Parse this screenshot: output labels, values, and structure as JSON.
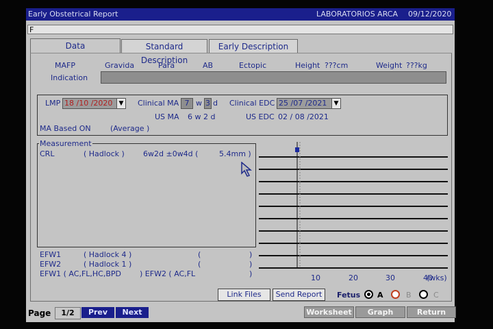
{
  "window": {
    "title": "Early Obstetrical Report",
    "clinic": "LABORATORIOS ARCA",
    "date": "09/12/2020"
  },
  "input_line": "F",
  "tabs": [
    {
      "label": "Data",
      "active": true
    },
    {
      "label": "Standard Description",
      "active": false
    },
    {
      "label": "Early Description",
      "active": false
    }
  ],
  "patient": {
    "mafp": "MAFP",
    "gravida": "Gravida",
    "para": "Para",
    "ab": "AB",
    "ectopic": "Ectopic",
    "height_label": "Height",
    "height_value": "???cm",
    "weight_label": "Weight",
    "weight_value": "???kg",
    "indication_label": "Indication",
    "indication_value": ""
  },
  "dates": {
    "lmp_label": "LMP",
    "lmp_value": "18 /10 /2020",
    "clinical_ma_label": "Clinical MA",
    "clinical_ma_w": "7",
    "w_label": "w",
    "clinical_ma_d": "3",
    "d_label": "d",
    "clinical_edc_label": "Clinical EDC",
    "clinical_edc_value": "25 /07 /2021",
    "us_ma_label": "US MA",
    "us_ma_value": "6 w 2 d",
    "us_edc_label": "US EDC",
    "us_edc_value": "02 / 08 /2021",
    "ma_based_label": "MA Based ON",
    "ma_based_value": "(Average     )"
  },
  "measurement": {
    "title": "Measurement",
    "rows": [
      {
        "name": "CRL",
        "method": "( Hadlock   )",
        "ga": "6w2d  ±0w4d (",
        "value": "5.4mm )"
      }
    ]
  },
  "efw": [
    {
      "name": "EFW1",
      "method": "( Hadlock 4 )",
      "open": "(",
      "close": ")"
    },
    {
      "name": "EFW2",
      "method": "( Hadlock 1 )",
      "open": "(",
      "close": ")"
    }
  ],
  "efw_footer": {
    "left": "EFW1 ( AC,FL,HC,BPD",
    "right": ") EFW2 ( AC,FL",
    "close": ")"
  },
  "graph": {
    "x_ticks": [
      "10",
      "20",
      "30",
      "40"
    ],
    "x_unit": "(wks)",
    "marker_week": 6.3,
    "line_count": 10
  },
  "buttons": {
    "link_files": "Link Files",
    "send_report": "Send Report"
  },
  "fetus": {
    "label": "Fetus",
    "options": [
      "A",
      "B",
      "C"
    ],
    "selected": "A"
  },
  "footer": {
    "page_label": "Page",
    "page_value": "1/2",
    "prev": "Prev",
    "next": "Next",
    "worksheet": "Worksheet",
    "graph": "Graph",
    "return": "Return"
  }
}
